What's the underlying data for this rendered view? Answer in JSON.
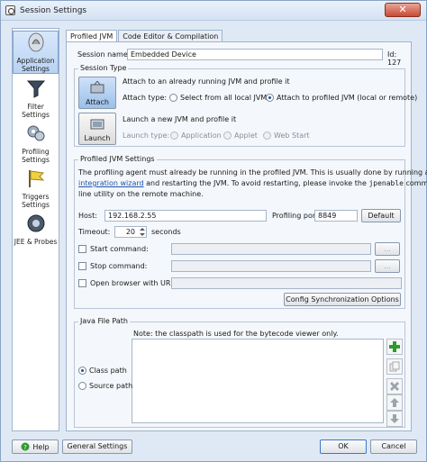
{
  "window": {
    "title": "Session Settings",
    "close_glyph": "✕"
  },
  "sidebar": {
    "items": [
      {
        "label": "Application Settings",
        "icon": "application-icon"
      },
      {
        "label": "Filter Settings",
        "icon": "filter-icon"
      },
      {
        "label": "Profiling Settings",
        "icon": "profiling-icon"
      },
      {
        "label": "Triggers Settings",
        "icon": "triggers-icon"
      },
      {
        "label": "JEE & Probes",
        "icon": "probes-icon"
      }
    ]
  },
  "tabs": [
    {
      "label": "Profiled JVM"
    },
    {
      "label": "Code Editor & Compilation"
    }
  ],
  "session": {
    "name_label": "Session name :",
    "name_value": "Embedded Device",
    "id_label": "Id: 127"
  },
  "session_type": {
    "title": "Session Type",
    "attach": {
      "button_label": "Attach",
      "description": "Attach to an already running JVM and profile it",
      "type_label": "Attach type:",
      "options": [
        "Select from all local JVMs",
        "Attach to profiled JVM (local or remote)"
      ]
    },
    "launch": {
      "button_label": "Launch",
      "description": "Launch a new JVM and profile it",
      "type_label": "Launch type:",
      "options": [
        "Application",
        "Applet",
        "Web Start"
      ]
    }
  },
  "jvm_settings": {
    "title": "Profiled JVM Settings",
    "desc_1": "The profiling agent must already be running in the profiled JVM. This is usually done by running an",
    "desc_link": "integration wizard",
    "desc_2": " and restarting the JVM. To avoid restarting, please invoke the ",
    "desc_cmd": "jpenable",
    "desc_3": " command",
    "desc_4": "line utility on the remote machine.",
    "host_label": "Host:",
    "host_value": "192.168.2.55",
    "port_label": "Profiling port:",
    "port_value": "8849",
    "default_label": "Default",
    "timeout_label": "Timeout:",
    "timeout_value": "20",
    "timeout_unit": "seconds",
    "start_label": "Start command:",
    "stop_label": "Stop command:",
    "browser_label": "Open browser with URL:",
    "browse_label": "...",
    "sync_label": "Config Synchronization Options"
  },
  "java_path": {
    "title": "Java File Path",
    "note": "Note: the classpath is used for the bytecode viewer only.",
    "options": [
      "Class path",
      "Source path"
    ]
  },
  "footer": {
    "help_label": "Help",
    "general_label": "General Settings",
    "ok_label": "OK",
    "cancel_label": "Cancel"
  },
  "colors": {
    "accent": "#1f4f8f",
    "close": "#c74a33",
    "add_green": "#2e9a2e"
  }
}
